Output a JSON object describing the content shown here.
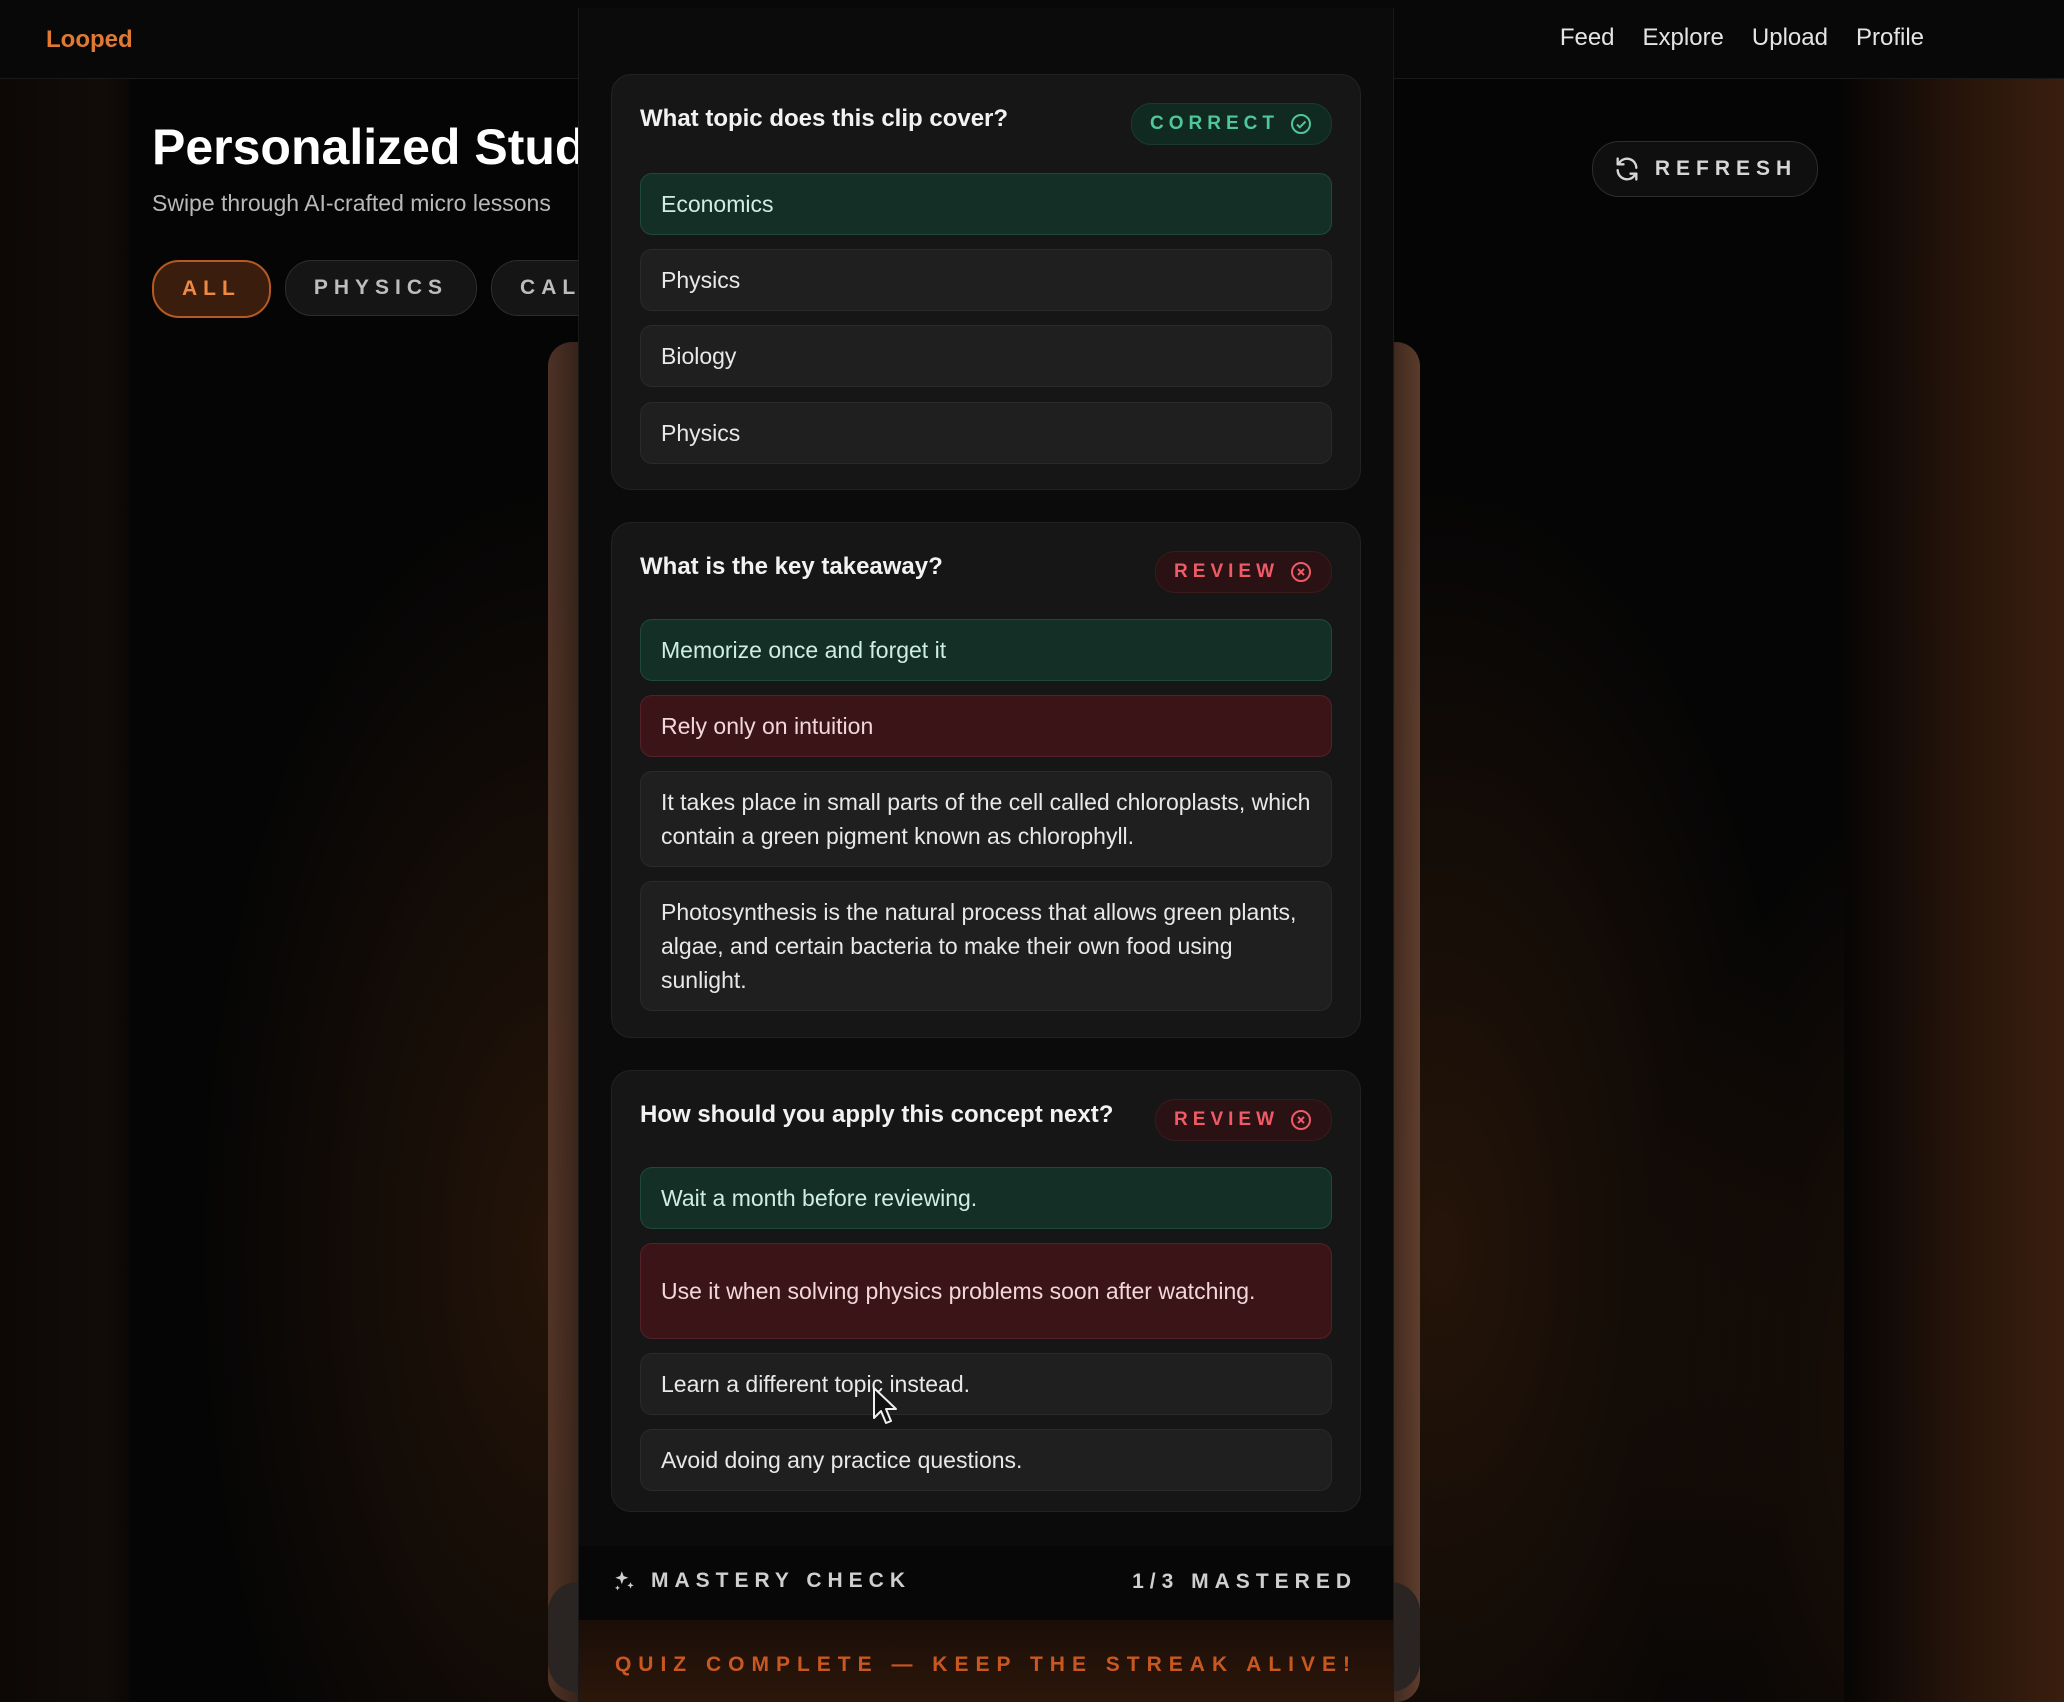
{
  "app": {
    "brand": "Looped"
  },
  "nav": {
    "items": [
      "Feed",
      "Explore",
      "Upload",
      "Profile"
    ]
  },
  "page": {
    "title": "Personalized Study",
    "subtitle": "Swipe through AI-crafted micro lessons",
    "filters": [
      "ALL",
      "PHYSICS",
      "CALC"
    ],
    "active_filter": "ALL",
    "refresh_label": "REFRESH"
  },
  "quiz": {
    "questions": [
      {
        "question": "What topic does this clip cover?",
        "badge": "CORRECT",
        "status": "correct",
        "options": [
          "Economics",
          "Physics",
          "Biology",
          "Physics"
        ]
      },
      {
        "question": "What is the key takeaway?",
        "badge": "REVIEW",
        "status": "review",
        "options": [
          "Memorize once and forget it",
          "Rely only on intuition",
          "It takes place in small parts of the cell called chloroplasts, which contain a green pigment known as chlorophyll.",
          "Photosynthesis is the natural process that allows green plants, algae, and certain bacteria to make their own food using sunlight."
        ]
      },
      {
        "question": "How should you apply this concept next?",
        "badge": "REVIEW",
        "status": "review",
        "options": [
          "Wait a month before reviewing.",
          "Use it when solving physics problems soon after watching.",
          "Learn a different topic instead.",
          "Avoid doing any practice questions."
        ]
      }
    ],
    "mastery_label": "MASTERY CHECK",
    "mastery_count": "1/3 MASTERED",
    "complete_message": "QUIZ COMPLETE — KEEP THE STREAK ALIVE!"
  },
  "colors": {
    "accent": "#e07a33",
    "correct": "#4fc79a",
    "review": "#ef5a66",
    "option_correct_bg": "#143026",
    "option_wrong_bg": "#3b1417"
  },
  "icons": {
    "correct_badge": "check-circle-icon",
    "review_badge": "x-circle-icon",
    "refresh": "refresh-icon",
    "mastery": "sparkle-icon"
  }
}
